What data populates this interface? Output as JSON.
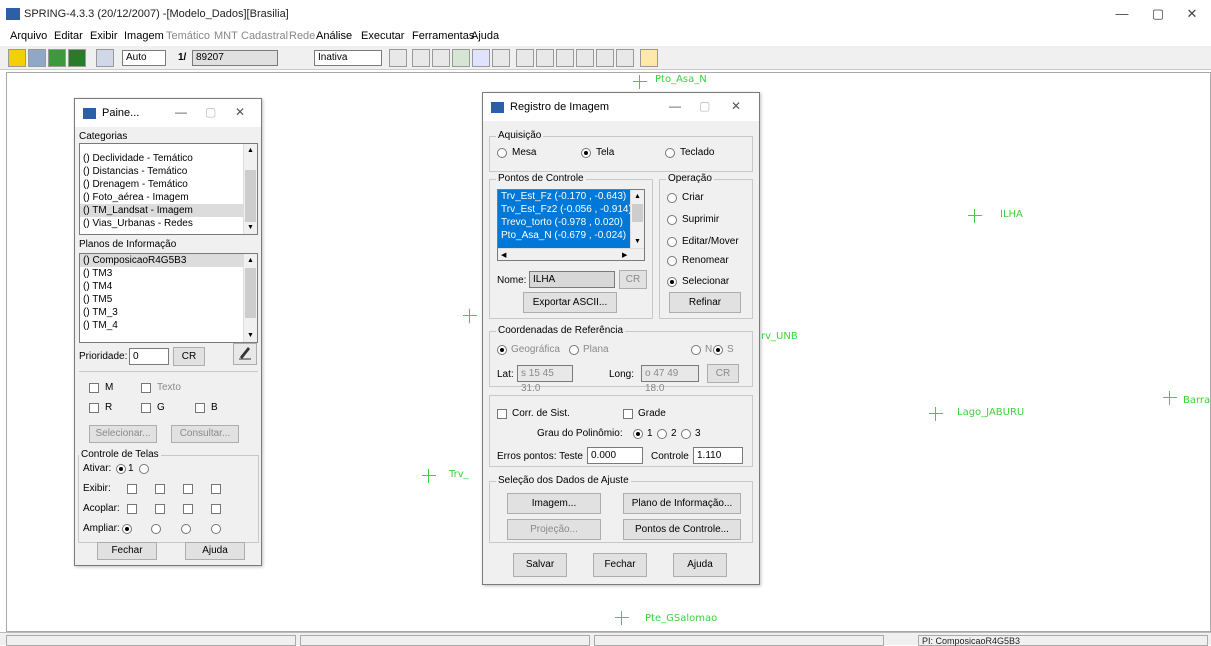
{
  "window": {
    "title": "SPRING-4.3.3 (20/12/2007) -[Modelo_Dados][Brasilia]",
    "min": "—",
    "max": "▢",
    "close": "✕"
  },
  "menu": [
    "Arquivo",
    "Editar",
    "Exibir",
    "Imagem",
    "Temático",
    "MNT",
    "Cadastral",
    "Rede",
    "Análise",
    "Executar",
    "Ferramentas",
    "Ajuda"
  ],
  "toolbar": {
    "zoom_mode": "Auto",
    "scale_prefix": "1/",
    "scale_value": "89207",
    "mode": "Inativa"
  },
  "canvas_points": [
    {
      "label": "Pto_Asa_N"
    },
    {
      "label": "ILHA"
    },
    {
      "label": "rv_UNB"
    },
    {
      "label": "Lago_JABURU"
    },
    {
      "label": "Barrag"
    },
    {
      "label": "Trv_"
    },
    {
      "label": "Pte_GSalomao"
    }
  ],
  "status": {
    "pi": "PI: ComposicaoR4G5B3"
  },
  "painel": {
    "title": "Paine...",
    "categorias_label": "Categorias",
    "categorias": [
      "() Declividade - Temático",
      "() Distancias - Temático",
      "() Drenagem - Temático",
      "() Foto_aérea - Imagem",
      "() TM_Landsat - Imagem",
      "() Vias_Urbanas - Redes"
    ],
    "planos_label": "Planos de Informação",
    "planos": [
      "() ComposicaoR4G5B3",
      "() TM3",
      "() TM4",
      "() TM5",
      "() TM_3",
      "() TM_4"
    ],
    "prioridade_label": "Prioridade:",
    "prioridade_value": "0",
    "cr": "CR",
    "m": "M",
    "texto": "Texto",
    "r": "R",
    "g": "G",
    "b": "B",
    "selecionar": "Selecionar...",
    "consultar": "Consultar...",
    "controle_label": "Controle de Telas",
    "ativar": "Ativar:",
    "exibir": "Exibir:",
    "acoplar": "Acoplar:",
    "ampliar": "Ampliar:",
    "fechar": "Fechar",
    "ajuda": "Ajuda"
  },
  "registro": {
    "title": "Registro de Imagem",
    "aquisicao_label": "Aquisição",
    "mesa": "Mesa",
    "tela": "Tela",
    "teclado": "Teclado",
    "pontos_label": "Pontos de Controle",
    "pontos": [
      "Trv_Est_Fz (-0.170 , -0.643)",
      "Trv_Est_Fz2 (-0.056 , -0.914)",
      "Trevo_torto (-0.978 , 0.020)",
      "Pto_Asa_N (-0.679 , -0.024)"
    ],
    "nome_label": "Nome:",
    "nome_value": "ILHA",
    "cr": "CR",
    "exportar": "Exportar ASCII...",
    "operacao_label": "Operação",
    "criar": "Criar",
    "suprimir": "Suprimir",
    "editar": "Editar/Mover",
    "renomear": "Renomear",
    "selecionar": "Selecionar",
    "refinar": "Refinar",
    "coord_label": "Coordenadas de Referência",
    "geografica": "Geográfica",
    "plana": "Plana",
    "n": "N",
    "s": "S",
    "lat_label": "Lat:",
    "lat_value": "s 15 45 31.0",
    "long_label": "Long:",
    "long_value": "o 47 49 18.0",
    "corr": "Corr. de Sist.",
    "grade": "Grade",
    "grau_label": "Grau do Polinômio:",
    "g1": "1",
    "g2": "2",
    "g3": "3",
    "erros_label": "Erros pontos:  Teste",
    "teste_value": "0.000",
    "controle_label": "Controle",
    "controle_value": "1.110",
    "selecao_label": "Seleção dos Dados de Ajuste",
    "imagem": "Imagem...",
    "plano": "Plano de Informação...",
    "projecao": "Projeção...",
    "pontos_btn": "Pontos de Controle...",
    "salvar": "Salvar",
    "fechar": "Fechar",
    "ajuda": "Ajuda"
  }
}
